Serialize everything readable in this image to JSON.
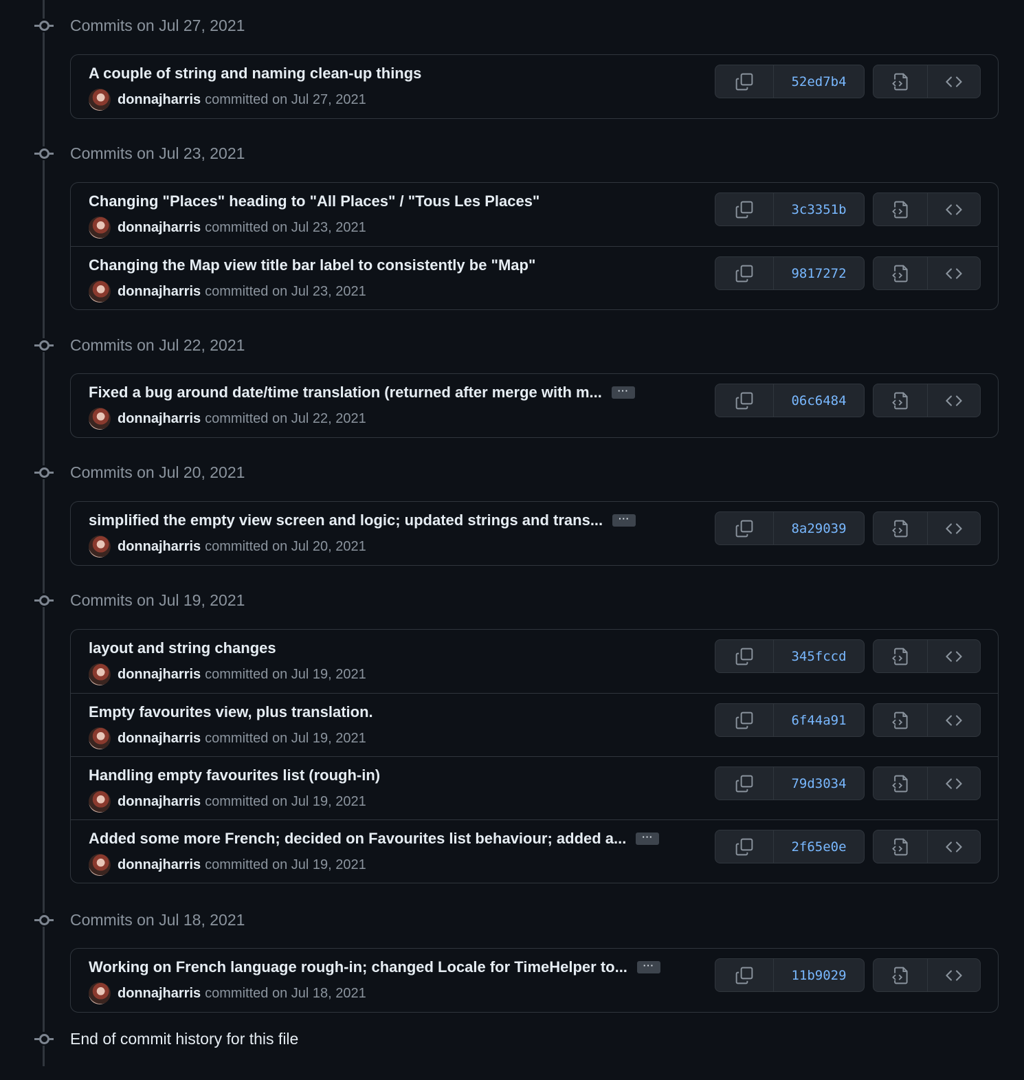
{
  "groups": [
    {
      "header": "Commits on Jul 27, 2021",
      "commits": [
        {
          "title": "A couple of string and naming clean-up things",
          "truncated": false,
          "author": "donnajharris",
          "meta": "committed on Jul 27, 2021",
          "sha": "52ed7b4"
        }
      ]
    },
    {
      "header": "Commits on Jul 23, 2021",
      "commits": [
        {
          "title": "Changing \"Places\" heading to \"All Places\" / \"Tous Les Places\"",
          "truncated": false,
          "author": "donnajharris",
          "meta": "committed on Jul 23, 2021",
          "sha": "3c3351b"
        },
        {
          "title": "Changing the Map view title bar label to consistently be \"Map\"",
          "truncated": false,
          "author": "donnajharris",
          "meta": "committed on Jul 23, 2021",
          "sha": "9817272"
        }
      ]
    },
    {
      "header": "Commits on Jul 22, 2021",
      "commits": [
        {
          "title": "Fixed a bug around date/time translation (returned after merge with m...",
          "truncated": true,
          "author": "donnajharris",
          "meta": "committed on Jul 22, 2021",
          "sha": "06c6484"
        }
      ]
    },
    {
      "header": "Commits on Jul 20, 2021",
      "commits": [
        {
          "title": "simplified the empty view screen and logic; updated strings and trans...",
          "truncated": true,
          "author": "donnajharris",
          "meta": "committed on Jul 20, 2021",
          "sha": "8a29039"
        }
      ]
    },
    {
      "header": "Commits on Jul 19, 2021",
      "commits": [
        {
          "title": "layout and string changes",
          "truncated": false,
          "author": "donnajharris",
          "meta": "committed on Jul 19, 2021",
          "sha": "345fccd"
        },
        {
          "title": "Empty favourites view, plus translation.",
          "truncated": false,
          "author": "donnajharris",
          "meta": "committed on Jul 19, 2021",
          "sha": "6f44a91"
        },
        {
          "title": "Handling empty favourites list (rough-in)",
          "truncated": false,
          "author": "donnajharris",
          "meta": "committed on Jul 19, 2021",
          "sha": "79d3034"
        },
        {
          "title": "Added some more French; decided on Favourites list behaviour; added a...",
          "truncated": true,
          "author": "donnajharris",
          "meta": "committed on Jul 19, 2021",
          "sha": "2f65e0e"
        }
      ]
    },
    {
      "header": "Commits on Jul 18, 2021",
      "commits": [
        {
          "title": "Working on French language rough-in; changed Locale for TimeHelper to...",
          "truncated": true,
          "author": "donnajharris",
          "meta": "committed on Jul 18, 2021",
          "sha": "11b9029"
        }
      ]
    }
  ],
  "expand_label": "···",
  "end_label": "End of commit history for this file",
  "icons": {
    "node": "git-commit-icon",
    "copy": "copy-icon",
    "view_file": "file-code-icon",
    "browse": "code-icon",
    "avatar": "avatar"
  },
  "colors": {
    "background": "#0d1117",
    "border": "#30363d",
    "button_bg": "#21262d",
    "sha": "#79b8ff",
    "muted": "#8b949e",
    "text": "#e6edf3"
  }
}
